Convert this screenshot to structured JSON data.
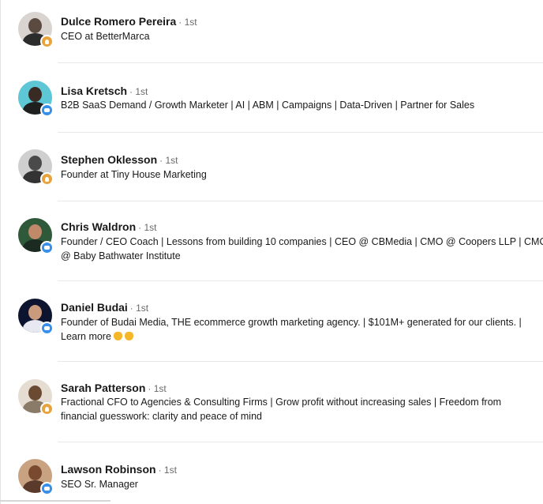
{
  "colors": {
    "badge_blue": "#378fe9",
    "badge_gold": "#e7a33e"
  },
  "connections": [
    {
      "name": "Dulce Romero Pereira",
      "degree": "· 1st",
      "headline_lines": [
        "CEO at BetterMarca"
      ],
      "badge_icon": "lightbulb-icon",
      "badge_color": "#e7a33e"
    },
    {
      "name": "Lisa Kretsch",
      "degree": "· 1st",
      "headline_lines": [
        "B2B SaaS Demand / Growth Marketer | AI | ABM | Campaigns | Data-Driven | Partner for Sales"
      ],
      "badge_icon": "hiring-icon",
      "badge_color": "#378fe9"
    },
    {
      "name": "Stephen Oklesson",
      "degree": "· 1st",
      "headline_lines": [
        "Founder at Tiny House Marketing"
      ],
      "badge_icon": "lightbulb-icon",
      "badge_color": "#e7a33e"
    },
    {
      "name": "Chris Waldron",
      "degree": "· 1st",
      "headline_lines": [
        "Founder / CEO Coach | Lessons from building 10 companies | CEO @ CBMedia | CMO @ Coopers LLP | CMO",
        "@ Baby Bathwater Institute"
      ],
      "badge_icon": "hiring-icon",
      "badge_color": "#378fe9"
    },
    {
      "name": "Daniel Budai",
      "degree": "· 1st",
      "headline_lines": [
        "Founder of Budai Media, THE ecommerce growth marketing agency. | $101M+ generated for our clients. |",
        "Learn more"
      ],
      "badge_icon": "hiring-icon",
      "badge_color": "#378fe9"
    },
    {
      "name": "Sarah Patterson",
      "degree": "· 1st",
      "headline_lines": [
        "Fractional CFO to Agencies & Consulting Firms | Grow profit without increasing sales | Freedom from",
        "financial guesswork: clarity and peace of mind"
      ],
      "badge_icon": "lightbulb-icon",
      "badge_color": "#e7a33e"
    },
    {
      "name": "Lawson Robinson",
      "degree": "· 1st",
      "headline_lines": [
        "SEO Sr. Manager"
      ],
      "badge_icon": "hiring-icon",
      "badge_color": "#378fe9"
    }
  ]
}
